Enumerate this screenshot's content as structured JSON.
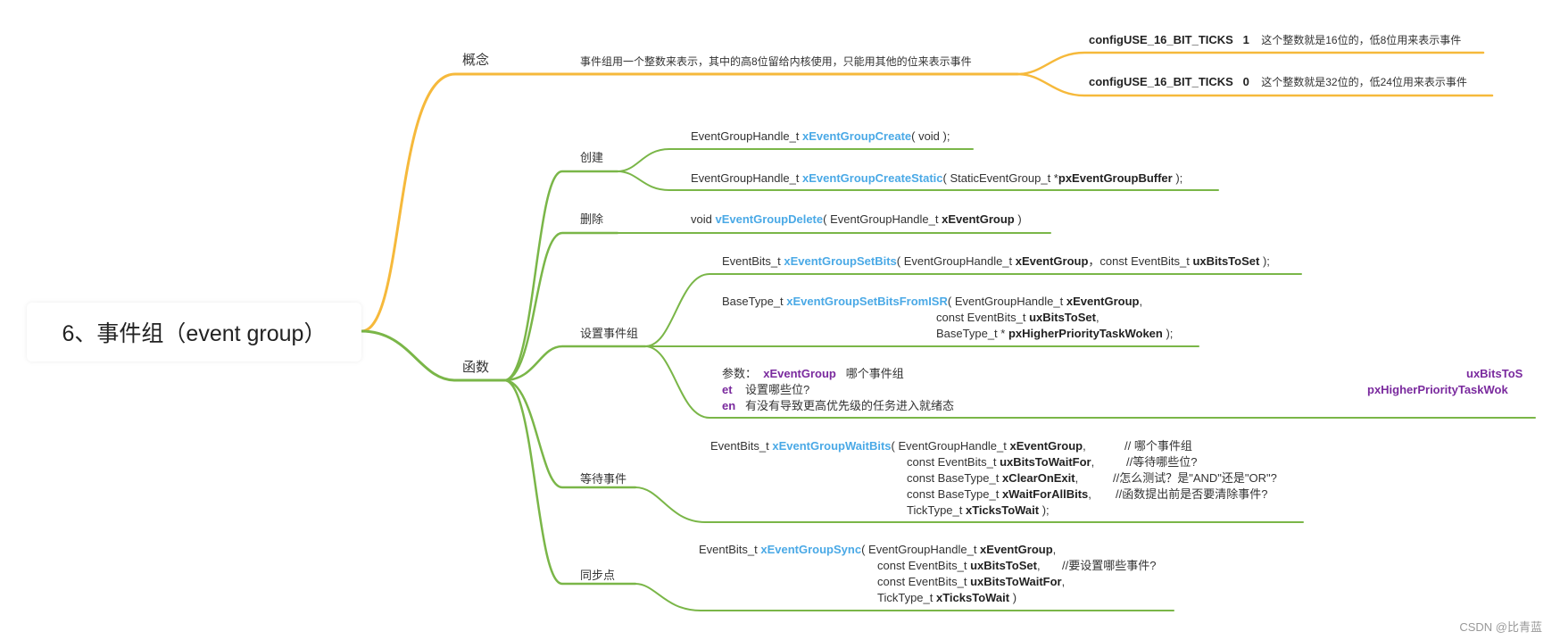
{
  "colors": {
    "orange": "#f6b93b",
    "green": "#7ab648",
    "func_name": "#4aa9e6",
    "param_purple": "#7a2a9e"
  },
  "root": {
    "title": "6、事件组（event group）"
  },
  "concept": {
    "label": "概念",
    "description": "事件组用一个整数来表示，其中的高8位留给内核使用，只能用其他的位来表示事件",
    "configs": [
      {
        "macro": "configUSE_16_BIT_TICKS   1",
        "note": "这个整数就是16位的，低8位用来表示事件"
      },
      {
        "macro": "configUSE_16_BIT_TICKS   0",
        "note": "这个整数就是32位的，低24位用来表示事件"
      }
    ]
  },
  "functions": {
    "label": "函数",
    "create": {
      "label": "创建",
      "line1": {
        "ret": "EventGroupHandle_t ",
        "name": "xEventGroupCreate",
        "args": "( void );"
      },
      "line2": {
        "ret": "EventGroupHandle_t ",
        "name": "xEventGroupCreateStatic",
        "pre": "( StaticEventGroup_t *",
        "arg": "pxEventGroupBuffer",
        "post": " );"
      }
    },
    "delete": {
      "label": "删除",
      "ret": "void ",
      "name": "vEventGroupDelete",
      "pre": "( EventGroupHandle_t ",
      "arg": "xEventGroup",
      "post": " )"
    },
    "set": {
      "label": "设置事件组",
      "line1": {
        "ret": "EventBits_t ",
        "name": "xEventGroupSetBits",
        "pre1": "( EventGroupHandle_t ",
        "arg1": "xEventGroup",
        "pre2": "，const EventBits_t ",
        "arg2": "uxBitsToSet",
        "post": " );"
      },
      "line2": {
        "ret": "BaseType_t ",
        "name": "xEventGroupSetBitsFromISR",
        "pre1": "( EventGroupHandle_t ",
        "arg1": "xEventGroup",
        "post1": ",",
        "row2_pre": "const EventBits_t ",
        "row2_arg": "uxBitsToSet",
        "row2_post": ",",
        "row3_pre": "BaseType_t * ",
        "row3_arg": "pxHigherPriorityTaskWoken",
        "row3_post": " );"
      },
      "params": {
        "label": "参数：",
        "p1_name": "xEventGroup",
        "p1_desc": "哪个事件组",
        "right1": "uxBitsToS",
        "p2_name": "et",
        "p2_desc": "设置哪些位?",
        "right2": "pxHigherPriorityTaskWok",
        "p3_name": "en",
        "p3_desc": "有没有导致更高优先级的任务进入就绪态"
      }
    },
    "wait": {
      "label": "等待事件",
      "ret": "EventBits_t ",
      "name": "xEventGroupWaitBits",
      "rows": [
        {
          "pre": "( EventGroupHandle_t ",
          "arg": "xEventGroup",
          "post": ",",
          "comment": "// 哪个事件组"
        },
        {
          "pre": "const EventBits_t ",
          "arg": "uxBitsToWaitFor",
          "post": ",",
          "comment": "//等待哪些位?"
        },
        {
          "pre": "const BaseType_t ",
          "arg": "xClearOnExit",
          "post": ",",
          "comment": "//怎么测试？是\"AND\"还是\"OR\"?"
        },
        {
          "pre": "const BaseType_t ",
          "arg": "xWaitForAllBits",
          "post": ",",
          "comment": "//函数提出前是否要清除事件?"
        },
        {
          "pre": "TickType_t ",
          "arg": "xTicksToWait",
          "post": " );",
          "comment": ""
        }
      ]
    },
    "sync": {
      "label": "同步点",
      "ret": "EventBits_t ",
      "name": "xEventGroupSync",
      "rows": [
        {
          "pre": "( EventGroupHandle_t ",
          "arg": "xEventGroup",
          "post": ",",
          "comment": ""
        },
        {
          "pre": "const EventBits_t ",
          "arg": "uxBitsToSet",
          "post": ",",
          "comment": "//要设置哪些事件?"
        },
        {
          "pre": "const EventBits_t ",
          "arg": "uxBitsToWaitFor",
          "post": ",",
          "comment": ""
        },
        {
          "pre": "TickType_t ",
          "arg": "xTicksToWait",
          "post": " )",
          "comment": ""
        }
      ]
    }
  },
  "watermark": "CSDN @比青蓝"
}
